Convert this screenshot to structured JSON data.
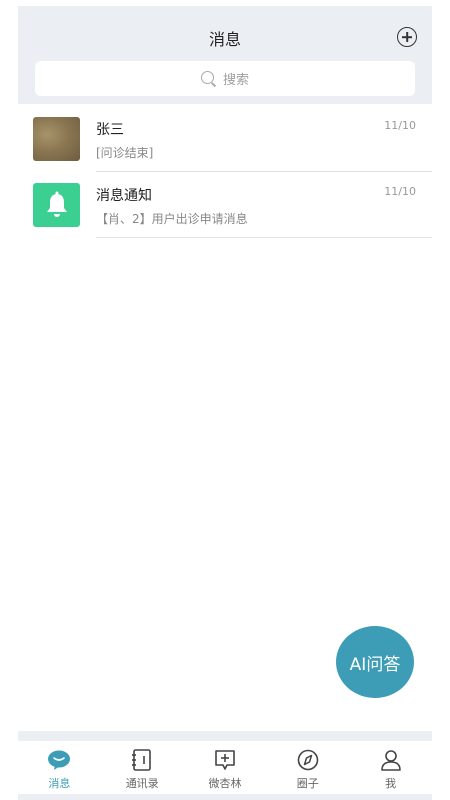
{
  "header": {
    "title": "消息",
    "search_placeholder": "搜索"
  },
  "conversations": [
    {
      "name": "张三",
      "preview": "[问诊结束]",
      "time": "11/10",
      "avatar": "photo"
    },
    {
      "name": "消息通知",
      "preview": "【肖、2】用户出诊申请消息",
      "time": "11/10",
      "avatar": "bell-icon"
    }
  ],
  "fab": {
    "label": "AI问答",
    "color": "#3d9db6"
  },
  "nav": {
    "items": [
      {
        "label": "消息",
        "icon": "chat-bubble-icon",
        "active": true
      },
      {
        "label": "通讯录",
        "icon": "address-book-icon",
        "active": false
      },
      {
        "label": "微杏林",
        "icon": "message-plus-icon",
        "active": false
      },
      {
        "label": "圈子",
        "icon": "compass-icon",
        "active": false
      },
      {
        "label": "我",
        "icon": "person-icon",
        "active": false
      }
    ]
  },
  "colors": {
    "accent": "#3d9db6",
    "notice": "#3ccf92",
    "header_bg": "#ebeff4"
  }
}
